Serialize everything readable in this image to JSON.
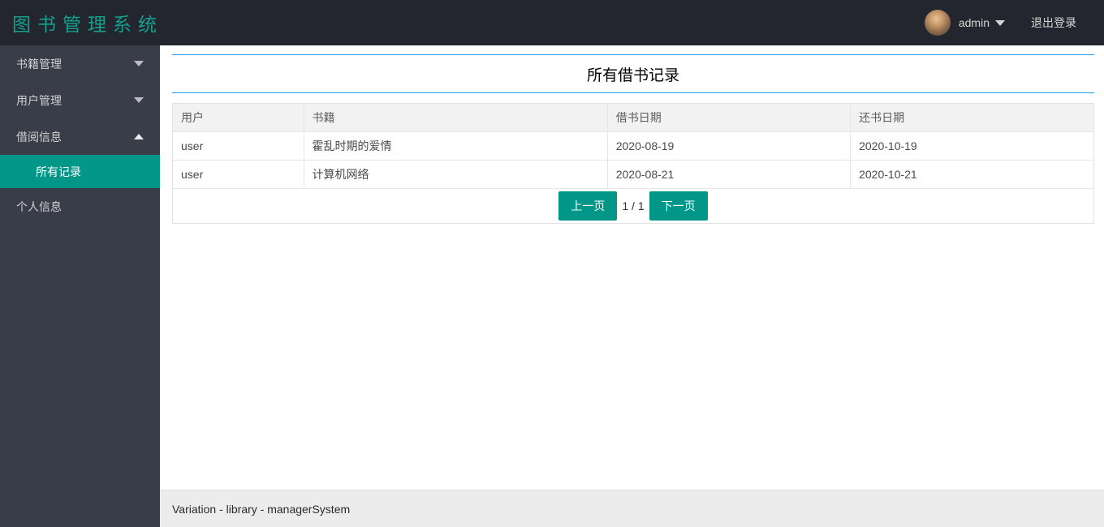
{
  "brand": {
    "title": "图书管理系统"
  },
  "header": {
    "username": "admin",
    "logout_label": "退出登录",
    "avatar": "user-photo-avatar"
  },
  "sidebar": {
    "items": [
      {
        "label": "书籍管理",
        "state": "collapsed"
      },
      {
        "label": "用户管理",
        "state": "collapsed"
      },
      {
        "label": "借阅信息",
        "state": "expanded",
        "children": [
          {
            "label": "所有记录",
            "active": true
          }
        ]
      },
      {
        "label": "个人信息",
        "state": "none"
      }
    ]
  },
  "main": {
    "page_title": "所有借书记录",
    "table": {
      "columns": [
        "用户",
        "书籍",
        "借书日期",
        "还书日期"
      ],
      "rows": [
        [
          "user",
          "霍乱时期的爱情",
          "2020-08-19",
          "2020-10-19"
        ],
        [
          "user",
          "计算机网络",
          "2020-08-21",
          "2020-10-21"
        ]
      ]
    },
    "pagination": {
      "prev_label": "上一页",
      "page_indicator": "1 / 1",
      "next_label": "下一页"
    }
  },
  "footer": {
    "text": "Variation - library - managerSystem"
  },
  "colors": {
    "header_bg": "#23262e",
    "sidebar_bg": "#393d49",
    "brand_teal": "#14a08c",
    "accent_teal": "#009688",
    "title_line_blue": "#1E9FFF",
    "table_header_bg": "#f2f2f2",
    "footer_bg": "#ececec"
  }
}
